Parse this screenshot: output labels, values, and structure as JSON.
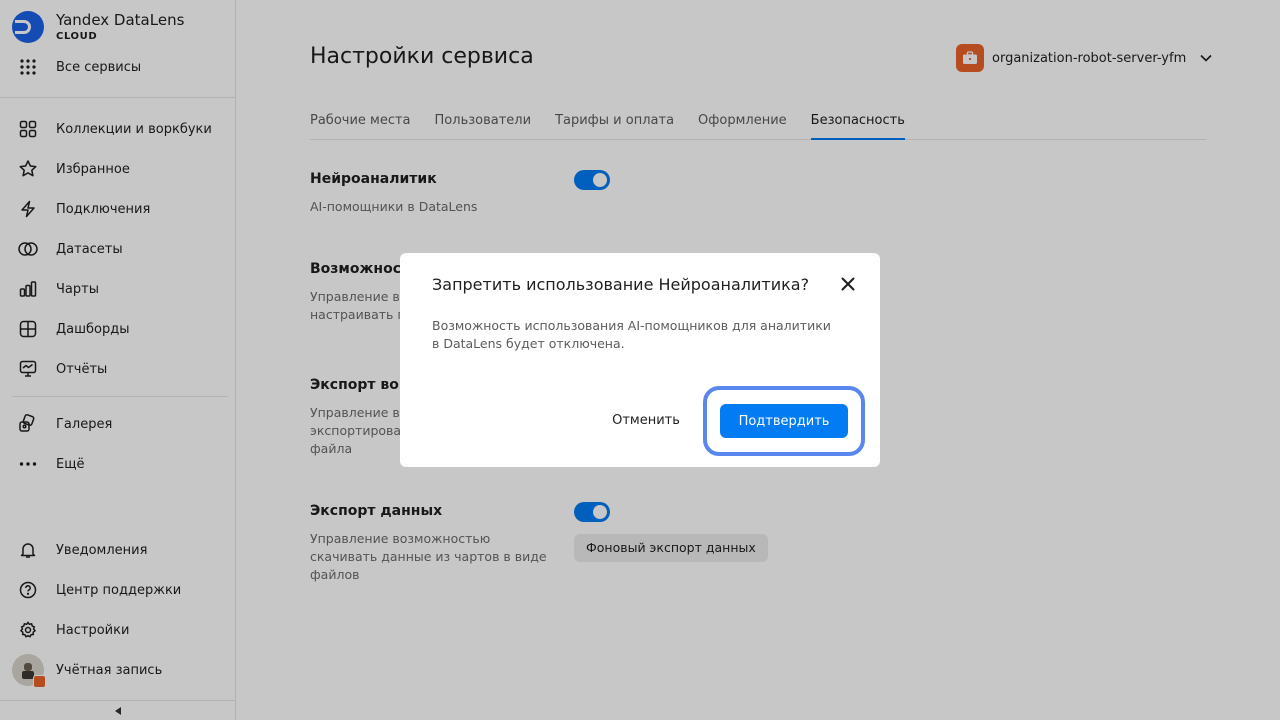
{
  "sidebar": {
    "brand": {
      "title": "Yandex DataLens",
      "subtitle": "CLOUD"
    },
    "all_services": "Все сервисы",
    "items": [
      {
        "label": "Коллекции и воркбуки",
        "icon": "grid-icon"
      },
      {
        "label": "Избранное",
        "icon": "star-icon"
      },
      {
        "label": "Подключения",
        "icon": "bolt-icon"
      },
      {
        "label": "Датасеты",
        "icon": "circles-icon"
      },
      {
        "label": "Чарты",
        "icon": "bar-chart-icon"
      },
      {
        "label": "Дашборды",
        "icon": "dashboard-icon"
      },
      {
        "label": "Отчёты",
        "icon": "report-icon"
      }
    ],
    "gallery": "Галерея",
    "more": "Ещё",
    "bottom": {
      "notifications": "Уведомления",
      "support": "Центр поддержки",
      "settings": "Настройки",
      "account": "Учётная запись"
    }
  },
  "header": {
    "title": "Настройки сервиса",
    "organization": "organization-robot-server-yfm"
  },
  "tabs": [
    {
      "label": "Рабочие места",
      "active": false
    },
    {
      "label": "Пользователи",
      "active": false
    },
    {
      "label": "Тарифы и оплата",
      "active": false
    },
    {
      "label": "Оформление",
      "active": false
    },
    {
      "label": "Безопасность",
      "active": true
    }
  ],
  "settings": {
    "neuro": {
      "title": "Нейроаналитик",
      "desc": "AI-помощники в DataLens",
      "enabled": true
    },
    "possibility": {
      "title": "Возможност",
      "desc_line1": "Управление во",
      "desc_line2": "настраивать пу"
    },
    "export_wb": {
      "title": "Экспорт ворк",
      "desc_line1": "Управление во",
      "desc_line2": "экспортироват",
      "desc_line3": "файла"
    },
    "export_data": {
      "title": "Экспорт данных",
      "desc": "Управление возможностью скачивать данные из чартов в виде файлов",
      "enabled": true,
      "button": "Фоновый экспорт данных"
    }
  },
  "dialog": {
    "title": "Запретить использование Нейроаналитика?",
    "text": "Возможность использования AI-помощников для аналитики в DataLens будет отключена.",
    "cancel": "Отменить",
    "confirm": "Подтвердить"
  },
  "colors": {
    "accent": "#027bf3",
    "focus_ring": "#5a87ee",
    "org_icon": "#e8632b"
  }
}
